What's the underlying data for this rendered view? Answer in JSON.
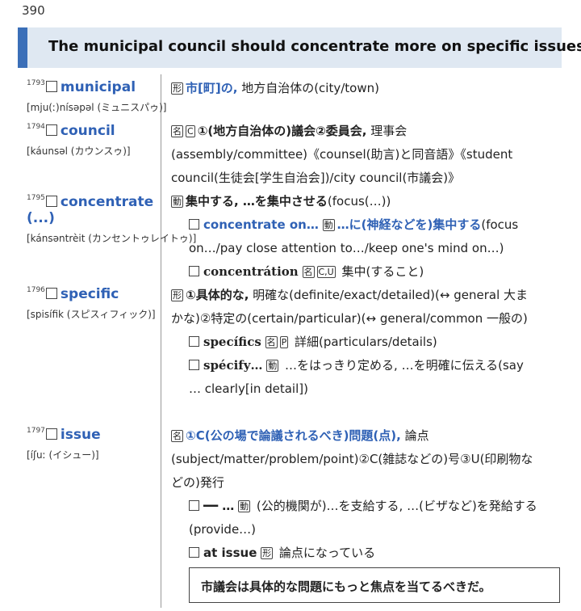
{
  "page_number": "390",
  "headline": "The municipal council should concentrate more on specific issues.",
  "entries": [
    {
      "number": "1793",
      "word": "municipal",
      "pron": "[mju(ː)nísəpəl (ミュニスパゥ)]",
      "lines": [
        {
          "tag": "形",
          "head": "市[町]の,",
          "rest": " 地方自治体の(city/town)"
        }
      ]
    },
    {
      "number": "1794",
      "word": "council",
      "pron": "[káunsəl (カウンスゥ)]",
      "lines": [
        {
          "tag": "名",
          "tag2": "C",
          "head": "①(地方自治体の)議会②委員会,",
          "rest": " 理事会(assembly/committee)《counsel(助言)と同音語》《student council(生徒会[学生自治会])/city council(市議会)》"
        }
      ]
    },
    {
      "number": "1795",
      "word": "concentrate (...)",
      "pron": "[kánsəntrèit (カンセントゥレイトゥ)]",
      "lines": [
        {
          "tag": "動",
          "head": "集中する, …を集中させる",
          "rest": "(focus(…))"
        },
        {
          "check": true,
          "phrase": "concentrate on…",
          "tag": "動",
          "head": "…に(神経などを)集中する",
          "rest": "(focus on…/pay close attention to…/keep one's mind on…)"
        },
        {
          "check": true,
          "phrase": "concentrátion",
          "tag": "名",
          "tag2": "C,U",
          "rest": " 集中(すること)"
        }
      ]
    },
    {
      "number": "1796",
      "word": "specific",
      "pron": "[spisífik (スピスィフィック)]",
      "lines": [
        {
          "tag": "形",
          "head": "①具体的な,",
          "rest": " 明確な(definite/exact/detailed)(↔ general 大まかな)②特定の(certain/particular)(↔ general/common 一般の)"
        },
        {
          "check": true,
          "phrase": "specífics",
          "tag": "名",
          "tag2": "P",
          "rest": " 詳細(particulars/details)"
        },
        {
          "check": true,
          "phrase": "spécify…",
          "tag": "動",
          "rest": " …をはっきり定める, …を明確に伝える(say … clearly[in detail])"
        }
      ]
    },
    {
      "number": "1797",
      "word": "issue",
      "pron": "[íʃuː (イシュー)]",
      "lines": [
        {
          "tag": "名",
          "head": "①C(公の場で論議されるべき)問題(点),",
          "rest": " 論点(subject/matter/problem/point)②C(雑誌などの)号③U(印刷物などの)発行"
        },
        {
          "check": true,
          "phrase": "━━ …",
          "tag": "動",
          "rest": " (公的機関が)…を支給する, …(ビザなど)を発給する(provide…)"
        },
        {
          "check": true,
          "phrase": "at issue",
          "tag": "形",
          "rest": " 論点になっている"
        }
      ]
    }
  ],
  "example_sentence": "市議会は具体的な問題にもっと焦点を当てるべきだ。"
}
